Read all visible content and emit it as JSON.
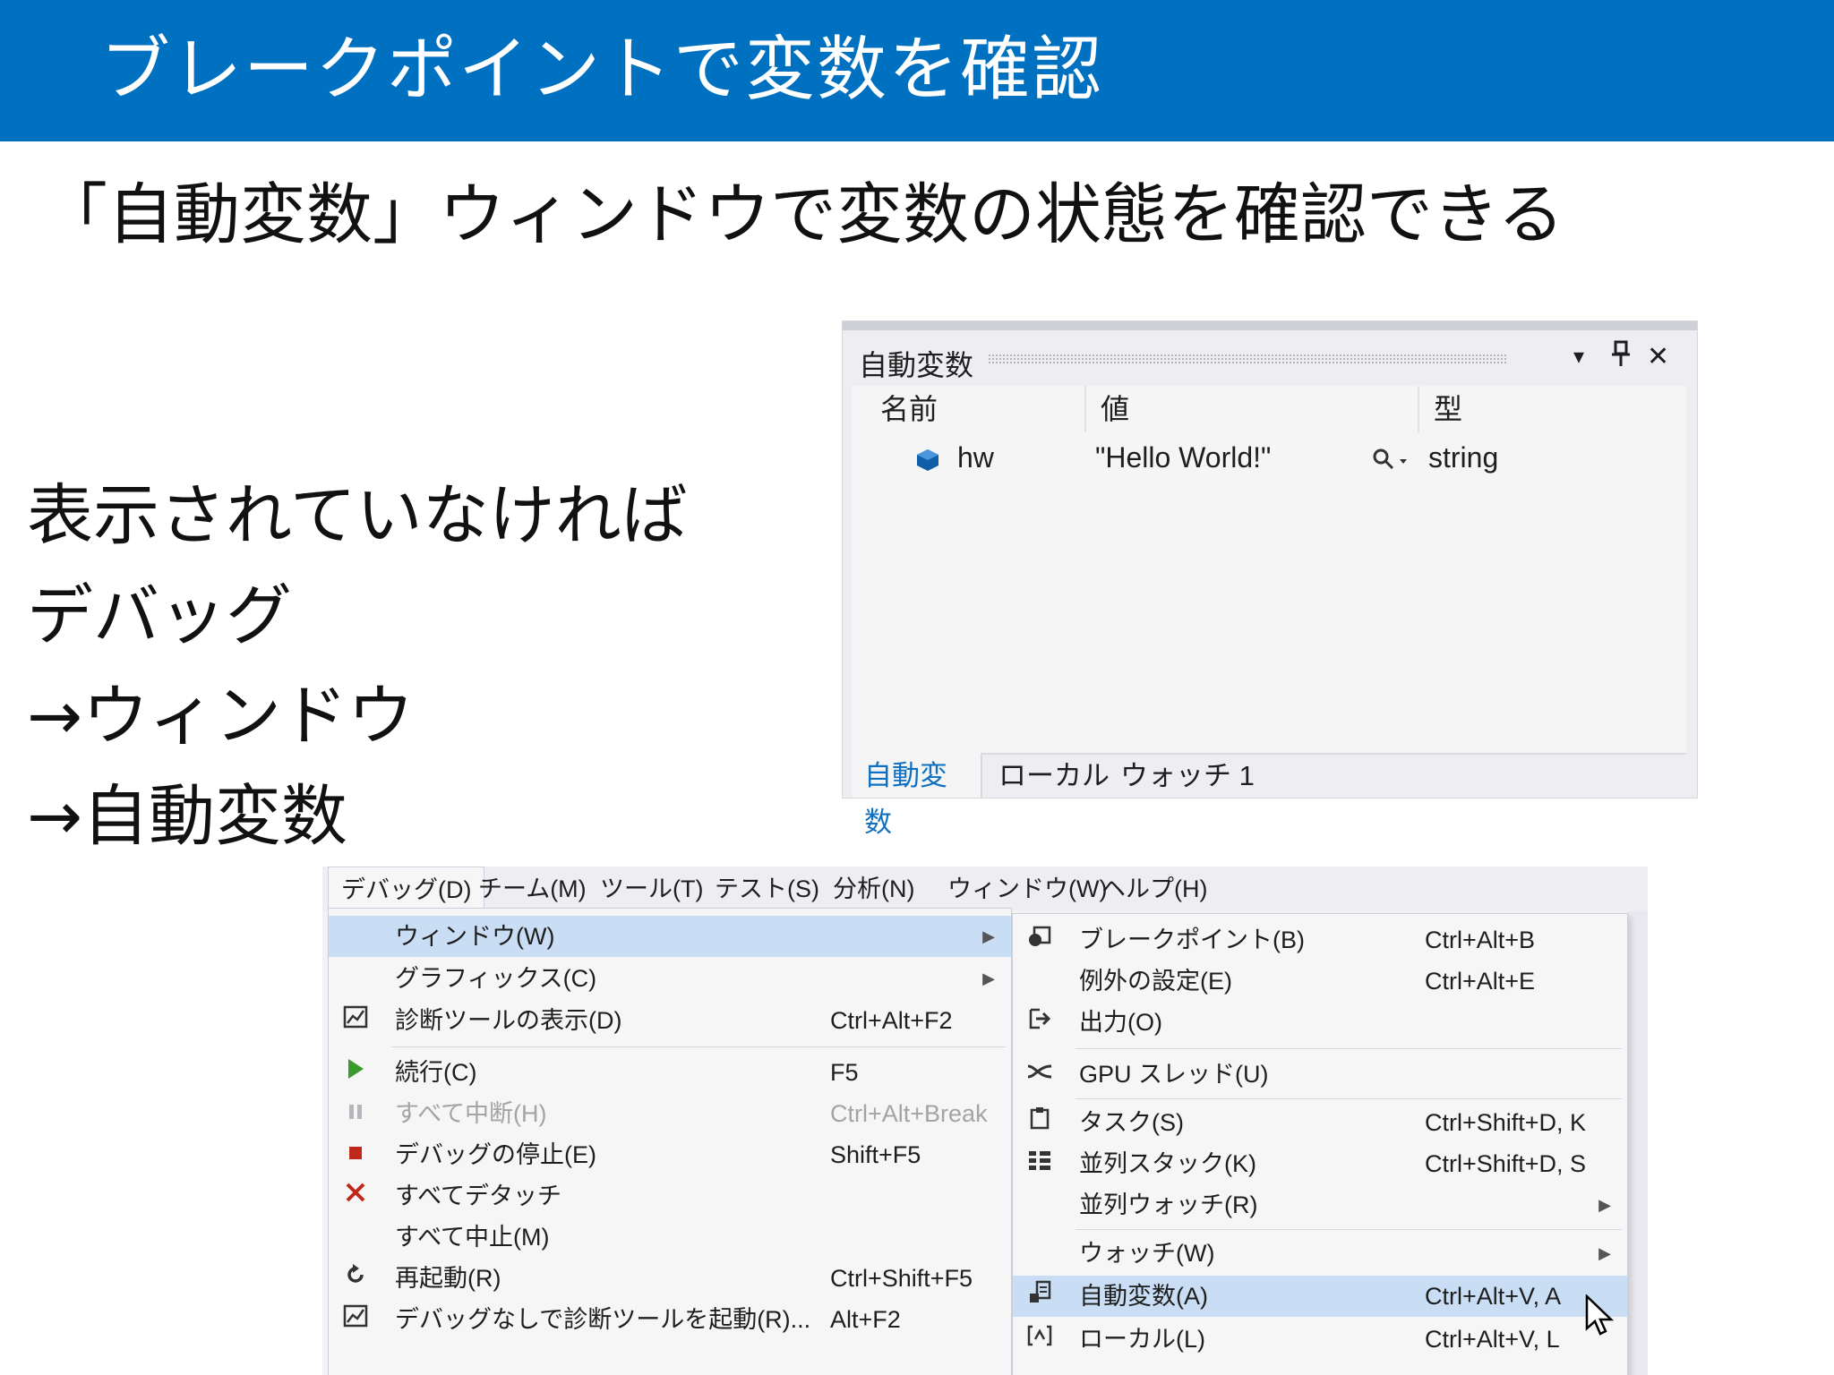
{
  "slide": {
    "title": "ブレークポイントで変数を確認",
    "subtitle": "「自動変数」ウィンドウで変数の状態を確認できる",
    "steps": [
      "表示されていなければ",
      "デバッグ",
      "→ウィンドウ",
      "→自動変数"
    ]
  },
  "autos": {
    "title": "自動変数",
    "columns": [
      "名前",
      "値",
      "型"
    ],
    "rows": [
      {
        "name": "hw",
        "value": "\"Hello World!\"",
        "type": "string"
      }
    ],
    "tabs": [
      "自動変数",
      "ローカル",
      "ウォッチ 1"
    ],
    "icons": {
      "dropdown": "▾",
      "pin": "⊥",
      "close": "✕",
      "search": "🔍"
    }
  },
  "menubar": [
    "デバッグ(D)",
    "チーム(M)",
    "ツール(T)",
    "テスト(S)",
    "分析(N)",
    "ウィンドウ(W)",
    "ヘルプ(H)"
  ],
  "debug_menu": [
    {
      "label": "ウィンドウ(W)",
      "shortcut": "",
      "icon": "",
      "submenu": true,
      "highlighted": true
    },
    {
      "label": "グラフィックス(C)",
      "shortcut": "",
      "icon": "",
      "submenu": true
    },
    {
      "label": "診断ツールの表示(D)",
      "shortcut": "Ctrl+Alt+F2",
      "icon": "chart-icon"
    },
    {
      "label": "続行(C)",
      "shortcut": "F5",
      "icon": "play-icon"
    },
    {
      "label": "すべて中断(H)",
      "shortcut": "Ctrl+Alt+Break",
      "icon": "pause-icon",
      "disabled": true
    },
    {
      "label": "デバッグの停止(E)",
      "shortcut": "Shift+F5",
      "icon": "stop-icon"
    },
    {
      "label": "すべてデタッチ",
      "shortcut": "",
      "icon": "detach-icon"
    },
    {
      "label": "すべて中止(M)",
      "shortcut": "",
      "icon": ""
    },
    {
      "label": "再起動(R)",
      "shortcut": "Ctrl+Shift+F5",
      "icon": "restart-icon"
    },
    {
      "label": "デバッグなしで診断ツールを起動(R)...",
      "shortcut": "Alt+F2",
      "icon": "chart-icon"
    }
  ],
  "window_submenu": [
    {
      "label": "ブレークポイント(B)",
      "shortcut": "Ctrl+Alt+B",
      "icon": "breakpoints-icon"
    },
    {
      "label": "例外の設定(E)",
      "shortcut": "Ctrl+Alt+E",
      "icon": ""
    },
    {
      "label": "出力(O)",
      "shortcut": "",
      "icon": "output-icon"
    },
    {
      "label": "GPU スレッド(U)",
      "shortcut": "",
      "icon": "gpu-threads-icon"
    },
    {
      "label": "タスク(S)",
      "shortcut": "Ctrl+Shift+D, K",
      "icon": "tasks-icon"
    },
    {
      "label": "並列スタック(K)",
      "shortcut": "Ctrl+Shift+D, S",
      "icon": "parallel-stacks-icon"
    },
    {
      "label": "並列ウォッチ(R)",
      "shortcut": "",
      "icon": "",
      "submenu": true
    },
    {
      "label": "ウォッチ(W)",
      "shortcut": "",
      "icon": "",
      "submenu": true
    },
    {
      "label": "自動変数(A)",
      "shortcut": "Ctrl+Alt+V, A",
      "icon": "autos-icon",
      "highlighted": true
    },
    {
      "label": "ローカル(L)",
      "shortcut": "Ctrl+Alt+V, L",
      "icon": "locals-icon"
    }
  ],
  "colors": {
    "title_bar": "#0070c0",
    "highlight": "#c9def5",
    "active_tab": "#0e70c0"
  }
}
